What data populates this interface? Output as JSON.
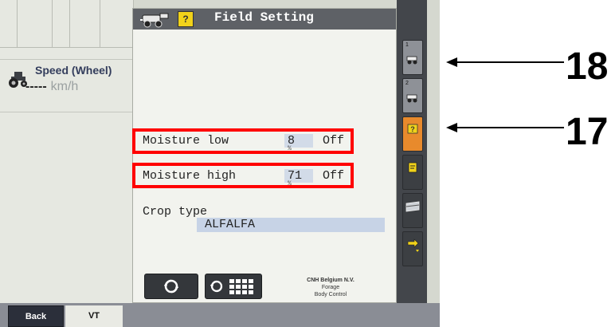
{
  "left_pane": {
    "speed_label": "Speed (Wheel)",
    "speed_value": "-----",
    "speed_unit": "km/h"
  },
  "panel": {
    "title": "Field Setting",
    "icons": [
      "forage-harvester-icon",
      "help-icon"
    ],
    "help_glyph": "?",
    "rows": [
      {
        "label": "Moisture low",
        "value": "8",
        "unit": "%",
        "status": "Off"
      },
      {
        "label": "Moisture high",
        "value": "71",
        "unit": "%",
        "status": "Off"
      }
    ],
    "crop_type_label": "Crop type",
    "crop_type_value": "ALFALFA",
    "footer_company": "CNH Belgium N.V.",
    "footer_line2": "Forage",
    "footer_line3": "Body Control"
  },
  "softkeys": [
    {
      "name": "softkey-1",
      "number": "1",
      "icon": "machine-icon"
    },
    {
      "name": "softkey-2",
      "number": "2",
      "icon": "machine-icon"
    },
    {
      "name": "softkey-3",
      "icon": "help-icon",
      "active": true
    },
    {
      "name": "softkey-4",
      "icon": "document-icon"
    },
    {
      "name": "softkey-5",
      "icon": "field-icon"
    },
    {
      "name": "softkey-6",
      "icon": "arrow-icon"
    }
  ],
  "bottom_bar": {
    "back_label": "Back",
    "vt_label": "VT"
  },
  "callouts": {
    "top_number": "18",
    "bottom_number": "17"
  },
  "colors": {
    "highlight": "#ff0000",
    "active_softkey": "#e88a2c",
    "title_bar": "#5e6166"
  }
}
